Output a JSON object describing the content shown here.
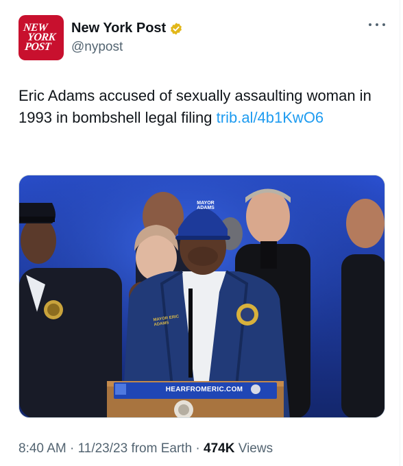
{
  "account": {
    "display_name": "New York Post",
    "handle": "@nypost",
    "logo_lines": [
      "NEW",
      "YORK",
      "POST"
    ],
    "verified_icon": "verified-badge-icon",
    "more_icon": "more-horizontal-icon"
  },
  "tweet": {
    "text": "Eric Adams accused of sexually assaulting woman in 1993 in bombshell legal filing ",
    "link_text": "trib.al/4b1KwO6"
  },
  "media": {
    "podium_sign": "HEARFROMERIC.COM",
    "cap_text": "MAYOR ADAMS",
    "jacket_text": "MAYOR ERIC ADAMS"
  },
  "meta": {
    "time": "8:40 AM",
    "sep1": " · ",
    "date": "11/23/23",
    "source": " from Earth",
    "sep2": " · ",
    "views_count": "474K",
    "views_label": " Views"
  },
  "colors": {
    "brand_red": "#c8102e",
    "link_blue": "#1d9bf0",
    "verified_gold": "#e2b719",
    "muted_text": "#536471"
  }
}
